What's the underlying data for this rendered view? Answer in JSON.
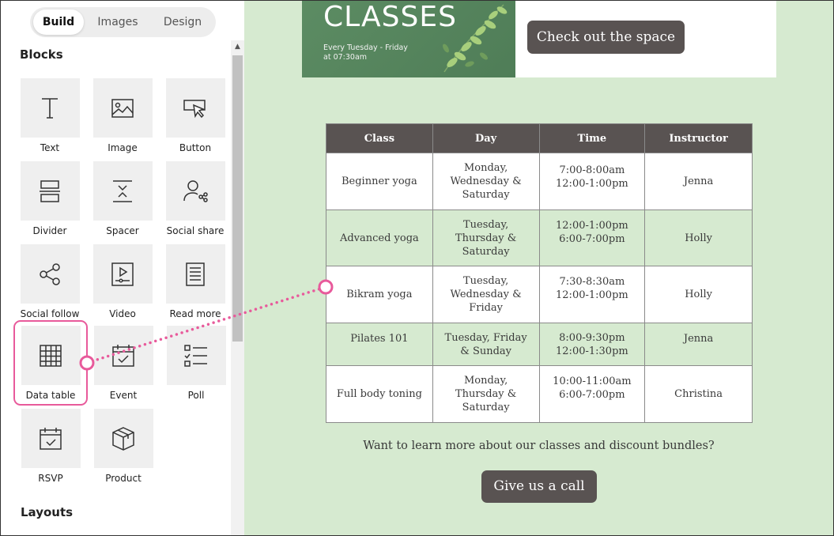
{
  "sidebar": {
    "tabs": [
      "Build",
      "Images",
      "Design"
    ],
    "active_tab": "Build",
    "blocks_title": "Blocks",
    "layouts_title": "Layouts",
    "blocks": [
      {
        "label": "Text",
        "icon": "text-icon"
      },
      {
        "label": "Image",
        "icon": "image-icon"
      },
      {
        "label": "Button",
        "icon": "button-icon"
      },
      {
        "label": "Divider",
        "icon": "divider-icon"
      },
      {
        "label": "Spacer",
        "icon": "spacer-icon"
      },
      {
        "label": "Social share",
        "icon": "social-share-icon"
      },
      {
        "label": "Social follow",
        "icon": "social-follow-icon"
      },
      {
        "label": "Video",
        "icon": "video-icon"
      },
      {
        "label": "Read more",
        "icon": "read-more-icon"
      },
      {
        "label": "Data table",
        "icon": "data-table-icon"
      },
      {
        "label": "Event",
        "icon": "event-icon"
      },
      {
        "label": "Poll",
        "icon": "poll-icon"
      },
      {
        "label": "RSVP",
        "icon": "rsvp-icon"
      },
      {
        "label": "Product",
        "icon": "product-icon"
      }
    ],
    "highlighted_block": "Data table"
  },
  "email": {
    "hero": {
      "title": "CLASSES",
      "subtitle_line1": "Every Tuesday - Friday",
      "subtitle_line2": "at 07:30am",
      "button": "Check out the space"
    },
    "table": {
      "headers": [
        "Class",
        "Day",
        "Time",
        "Instructor"
      ],
      "rows": [
        {
          "class": "Beginner yoga",
          "day": [
            "Monday,",
            "Wednesday &",
            "Saturday"
          ],
          "time": [
            "7:00-8:00am",
            "12:00-1:00pm"
          ],
          "instructor": "Jenna"
        },
        {
          "class": "Advanced yoga",
          "day": [
            "Tuesday,",
            "Thursday &",
            "Saturday"
          ],
          "time": [
            "12:00-1:00pm",
            "6:00-7:00pm"
          ],
          "instructor": "Holly"
        },
        {
          "class": "Bikram yoga",
          "day": [
            "Tuesday,",
            "Wednesday &",
            "Friday"
          ],
          "time": [
            "7:30-8:30am",
            "12:00-1:00pm"
          ],
          "instructor": "Holly"
        },
        {
          "class": "Pilates 101",
          "day": [
            "Tuesday, Friday",
            "& Sunday"
          ],
          "time": [
            "8:00-9:30pm",
            "12:00-1:30pm"
          ],
          "instructor": "Jenna"
        },
        {
          "class": "Full body toning",
          "day": [
            "Monday,",
            "Thursday &",
            "Saturday"
          ],
          "time": [
            "10:00-11:00am",
            "6:00-7:00pm"
          ],
          "instructor": "Christina"
        }
      ]
    },
    "cta_text": "Want to learn more about our classes and discount bundles?",
    "cta_button": "Give us a call"
  },
  "colors": {
    "accent_pink": "#e85a9b",
    "button_dark": "#595352",
    "canvas_green": "#d6ead0",
    "hero_green": "#5c8c63"
  }
}
